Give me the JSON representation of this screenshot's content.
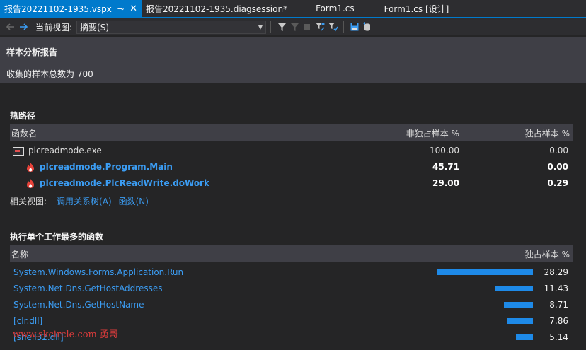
{
  "tabs": [
    {
      "label": "报告20221102-1935.vspx",
      "active": true,
      "pin": "⊸",
      "close": "✕"
    },
    {
      "label": "报告20221102-1935.diagsession*"
    },
    {
      "label": "Form1.cs"
    },
    {
      "label": "Form1.cs [设计]"
    }
  ],
  "toolbar": {
    "current_view_label": "当前视图:",
    "current_view_value": "摘要(S)"
  },
  "summary": {
    "title": "样本分析报告",
    "count_text": "收集的样本总数为 700"
  },
  "hot_path": {
    "title": "热路径",
    "headers": {
      "name": "函数名",
      "inclusive": "非独占样本 %",
      "exclusive": "独占样本 %"
    },
    "rows": [
      {
        "name": "plcreadmode.exe",
        "inclusive": "100.00",
        "exclusive": "0.00"
      },
      {
        "name": "plcreadmode.Program.Main",
        "inclusive": "45.71",
        "exclusive": "0.00"
      },
      {
        "name": "plcreadmode.PlcReadWrite.doWork",
        "inclusive": "29.00",
        "exclusive": "0.29"
      }
    ],
    "related_label": "相关视图:",
    "related_links": [
      "调用关系树(A)",
      "函数(N)"
    ]
  },
  "top_functions": {
    "title": "执行单个工作最多的函数",
    "headers": {
      "name": "名称",
      "exclusive": "独占样本 %"
    },
    "rows": [
      {
        "name": "System.Windows.Forms.Application.Run",
        "value": "28.29",
        "fraction": 1.0
      },
      {
        "name": "System.Net.Dns.GetHostAddresses",
        "value": "11.43",
        "fraction": 0.4
      },
      {
        "name": "System.Net.Dns.GetHostName",
        "value": "8.71",
        "fraction": 0.3
      },
      {
        "name": "[clr.dll]",
        "value": "7.86",
        "fraction": 0.27
      },
      {
        "name": "[shell32.dll]",
        "value": "5.14",
        "fraction": 0.18
      }
    ]
  },
  "watermark": "www.skcircle.com 勇哥"
}
